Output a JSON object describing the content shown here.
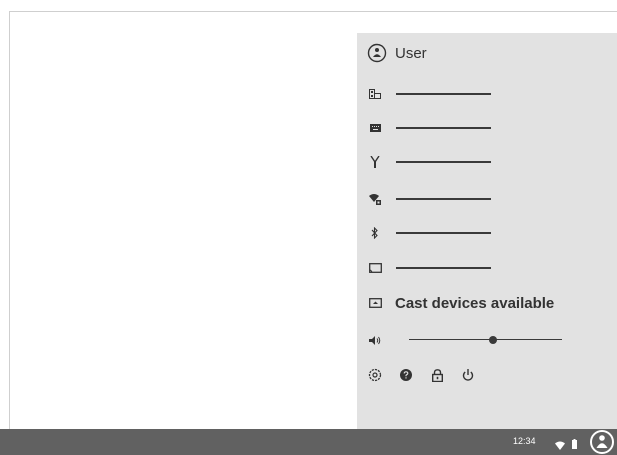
{
  "user": {
    "name": "User"
  },
  "menu_items": [
    {
      "icon": "network-icon"
    },
    {
      "icon": "keyboard-icon"
    },
    {
      "icon": "antenna-icon"
    },
    {
      "icon": "wifi-lock-icon"
    },
    {
      "icon": "bluetooth-icon"
    },
    {
      "icon": "display-icon"
    }
  ],
  "cast": {
    "label": "Cast devices available"
  },
  "volume": {
    "level": 0.55
  },
  "shelf": {
    "time": "12:34"
  },
  "colors": {
    "tray_bg": "#e2e2e2",
    "shelf_bg": "#616161",
    "icon": "#3a3a3a"
  }
}
